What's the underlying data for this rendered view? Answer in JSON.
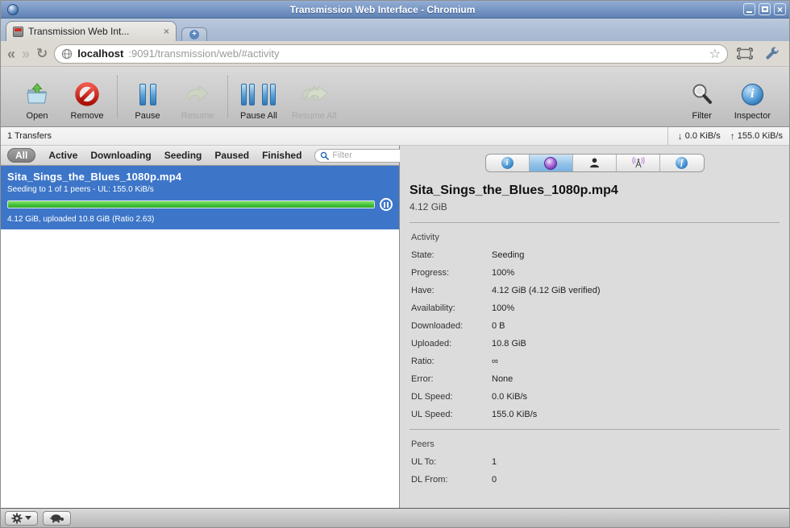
{
  "window": {
    "title": "Transmission Web Interface - Chromium",
    "close_glyph": "×"
  },
  "browser": {
    "tab_title": "Transmission Web Int...",
    "tab_close_glyph": "×",
    "new_tab_glyph": "+",
    "back_glyph": "«",
    "forward_glyph": "»",
    "reload_glyph": "↻",
    "star_glyph": "☆",
    "url": {
      "host": "localhost",
      "rest": ":9091/transmission/web/#activity"
    }
  },
  "toolbar": {
    "open_label": "Open",
    "remove_label": "Remove",
    "pause_label": "Pause",
    "resume_label": "Resume",
    "pause_all_label": "Pause All",
    "resume_all_label": "Resume All",
    "filter_label": "Filter",
    "inspector_label": "Inspector",
    "inspector_glyph": "i"
  },
  "statusbar": {
    "transfers": "1 Transfers",
    "down_arrow": "↓",
    "down_speed": "0.0 KiB/s",
    "up_arrow": "↑",
    "up_speed": "155.0 KiB/s"
  },
  "filterbar": {
    "tabs": [
      "All",
      "Active",
      "Downloading",
      "Seeding",
      "Paused",
      "Finished"
    ],
    "selected": "All",
    "search_placeholder": "Filter"
  },
  "torrent": {
    "name": "Sita_Sings_the_Blues_1080p.mp4",
    "status": "Seeding to 1 of 1 peers - UL: 155.0 KiB/s",
    "progress_pct": 100,
    "details": "4.12 GiB, uploaded 10.8 GiB (Ratio 2.63)"
  },
  "inspector": {
    "selected_tab": "activity",
    "tab_glyphs": {
      "info": "i",
      "files": "f"
    },
    "title": "Sita_Sings_the_Blues_1080p.mp4",
    "size": "4.12 GiB",
    "activity": {
      "heading": "Activity",
      "rows": [
        {
          "label": "State:",
          "value": "Seeding"
        },
        {
          "label": "Progress:",
          "value": "100%"
        },
        {
          "label": "Have:",
          "value": "4.12 GiB (4.12 GiB verified)"
        },
        {
          "label": "Availability:",
          "value": "100%"
        },
        {
          "label": "Downloaded:",
          "value": "0 B"
        },
        {
          "label": "Uploaded:",
          "value": "10.8 GiB"
        },
        {
          "label": "Ratio:",
          "value": "∞"
        },
        {
          "label": "Error:",
          "value": "None"
        },
        {
          "label": "DL Speed:",
          "value": "0.0 KiB/s"
        },
        {
          "label": "UL Speed:",
          "value": "155.0 KiB/s"
        }
      ]
    },
    "peers": {
      "heading": "Peers",
      "rows": [
        {
          "label": "UL To:",
          "value": "1"
        },
        {
          "label": "DL From:",
          "value": "0"
        }
      ]
    }
  },
  "colors": {
    "titlebar_blue": "#7b99c6",
    "selection_blue": "#3d76c8",
    "progress_green": "#44c43a",
    "selected_tab_blue": "#8fc0e8",
    "remove_red": "#c81e14"
  }
}
